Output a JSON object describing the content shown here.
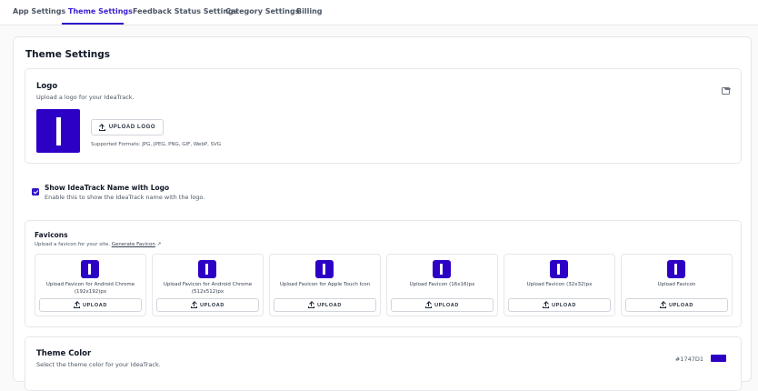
{
  "tabs": [
    {
      "label": "App Settings"
    },
    {
      "label": "Theme Settings"
    },
    {
      "label": "Feedback Status Settings"
    },
    {
      "label": "Category Settings"
    },
    {
      "label": "Billing"
    }
  ],
  "active_tab": "Theme Settings",
  "page_title": "Theme Settings",
  "logo": {
    "title": "Logo",
    "subtitle": "Upload a logo for your IdeaTrack.",
    "upload_label": "UPLOAD LOGO",
    "formats": "Supported Formats: JPG, JPEG, PNG, GIF, WebP, SVG",
    "icon": "image-icon"
  },
  "show_name": {
    "checked": true,
    "title": "Show IdeaTrack Name with Logo",
    "subtitle": "Enable this to show the IdeaTrack name with the logo."
  },
  "favicons": {
    "title": "Favicons",
    "subtitle": "Upload a favicon for your site.",
    "generate_link": "Generate Favicon",
    "generate_link_suffix": "↗",
    "items": [
      {
        "label": "Upload Favicon for Android Chrome (192x192)px",
        "button": "UPLOAD"
      },
      {
        "label": "Upload Favicon for Android Chrome (512x512)px",
        "button": "UPLOAD"
      },
      {
        "label": "Upload Favicon for Apple Touch Icon",
        "button": "UPLOAD"
      },
      {
        "label": "Upload Favicon (16x16)px",
        "button": "UPLOAD"
      },
      {
        "label": "Upload Favicon (32x32)px",
        "button": "UPLOAD"
      },
      {
        "label": "Upload Favicon",
        "button": "UPLOAD"
      }
    ]
  },
  "theme_color": {
    "title": "Theme Color",
    "subtitle": "Select the theme color for your IdeaTrack.",
    "hex": "#1747D1"
  },
  "colors": {
    "accent": "#2d16c9",
    "brand_block": "#2d00c6"
  }
}
